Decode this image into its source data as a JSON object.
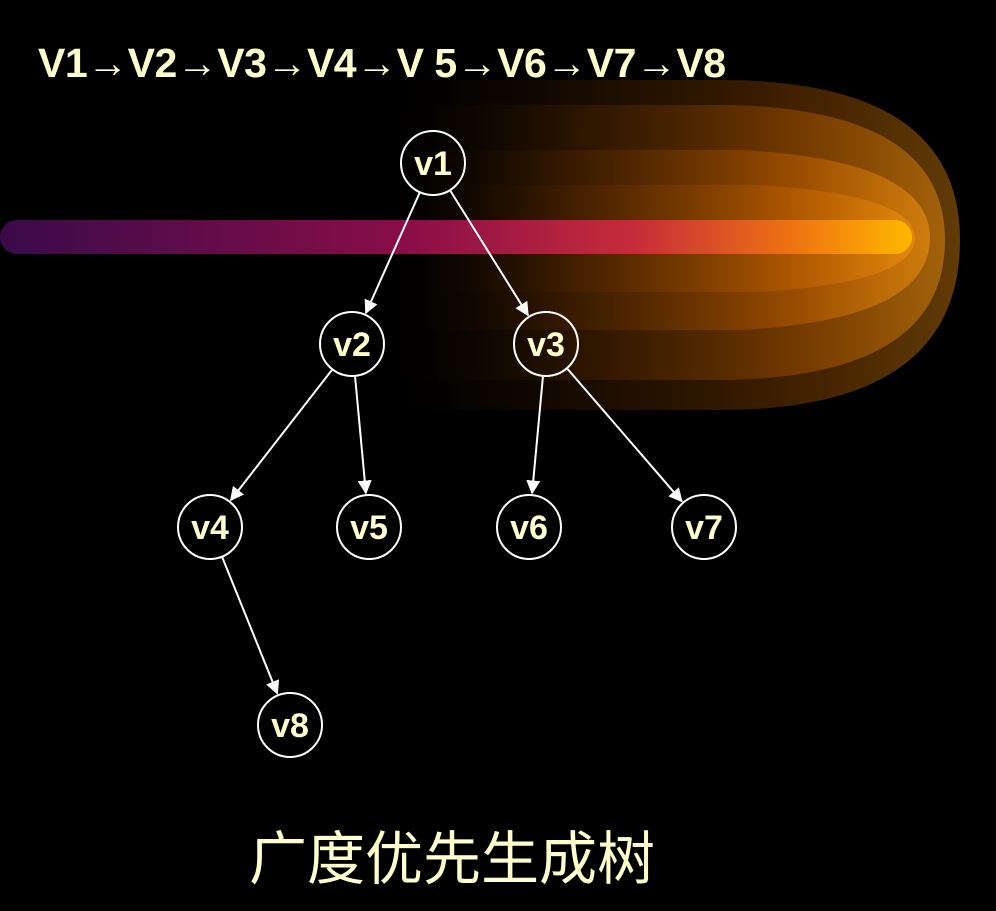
{
  "sequence_text": "V1→V2→V3→V4→V 5→V6→V7→V8",
  "caption": "广度优先生成树",
  "colors": {
    "background": "#000000",
    "text": "#FFFFCC",
    "edge": "#FFFFFF",
    "beam_start": "#3A0A4A",
    "beam_mid": "#A0104A",
    "beam_end": "#FFB000",
    "flame": "#FF8A00"
  },
  "tree": {
    "root": "v1",
    "nodes": [
      {
        "id": "v1",
        "label": "v1"
      },
      {
        "id": "v2",
        "label": "v2"
      },
      {
        "id": "v3",
        "label": "v3"
      },
      {
        "id": "v4",
        "label": "v4"
      },
      {
        "id": "v5",
        "label": "v5"
      },
      {
        "id": "v6",
        "label": "v6"
      },
      {
        "id": "v7",
        "label": "v7"
      },
      {
        "id": "v8",
        "label": "v8"
      }
    ],
    "edges": [
      {
        "from": "v1",
        "to": "v2"
      },
      {
        "from": "v1",
        "to": "v3"
      },
      {
        "from": "v2",
        "to": "v4"
      },
      {
        "from": "v2",
        "to": "v5"
      },
      {
        "from": "v3",
        "to": "v6"
      },
      {
        "from": "v3",
        "to": "v7"
      },
      {
        "from": "v4",
        "to": "v8"
      }
    ]
  }
}
